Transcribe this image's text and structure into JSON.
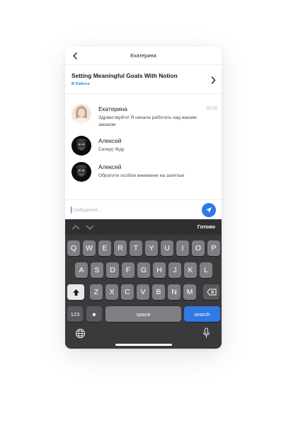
{
  "header": {
    "title": "Екатерина"
  },
  "order": {
    "title": "Setting Meaningful Goals With Notion",
    "status": "В Работе"
  },
  "messages": [
    {
      "name": "Екатерина",
      "text": "Здравствуйте! Я начала работать над вашим заказом",
      "time": "15:05",
      "avatar": "female-avatar"
    },
    {
      "name": "Алексей",
      "text": "Сепер) Жду",
      "avatar": "dark-avatar"
    },
    {
      "name": "Алексей",
      "text": "Обратите особое внимание на запятые",
      "avatar": "dark-avatar"
    }
  ],
  "composer": {
    "placeholder": "Сообщение..."
  },
  "keyboard": {
    "done_label": "Готово",
    "row1": [
      "Q",
      "W",
      "E",
      "R",
      "T",
      "Y",
      "U",
      "I",
      "O",
      "P"
    ],
    "row2": [
      "A",
      "S",
      "D",
      "F",
      "G",
      "H",
      "J",
      "K",
      "L"
    ],
    "row3": [
      "Z",
      "X",
      "C",
      "V",
      "B",
      "N",
      "M"
    ],
    "numbers_label": "123",
    "emoji_label": "☻",
    "space_label": "space",
    "search_label": "search"
  },
  "colors": {
    "accent": "#2f7ae5",
    "keyboard_bg": "#3a3a3c",
    "key": "#7f7f83"
  }
}
